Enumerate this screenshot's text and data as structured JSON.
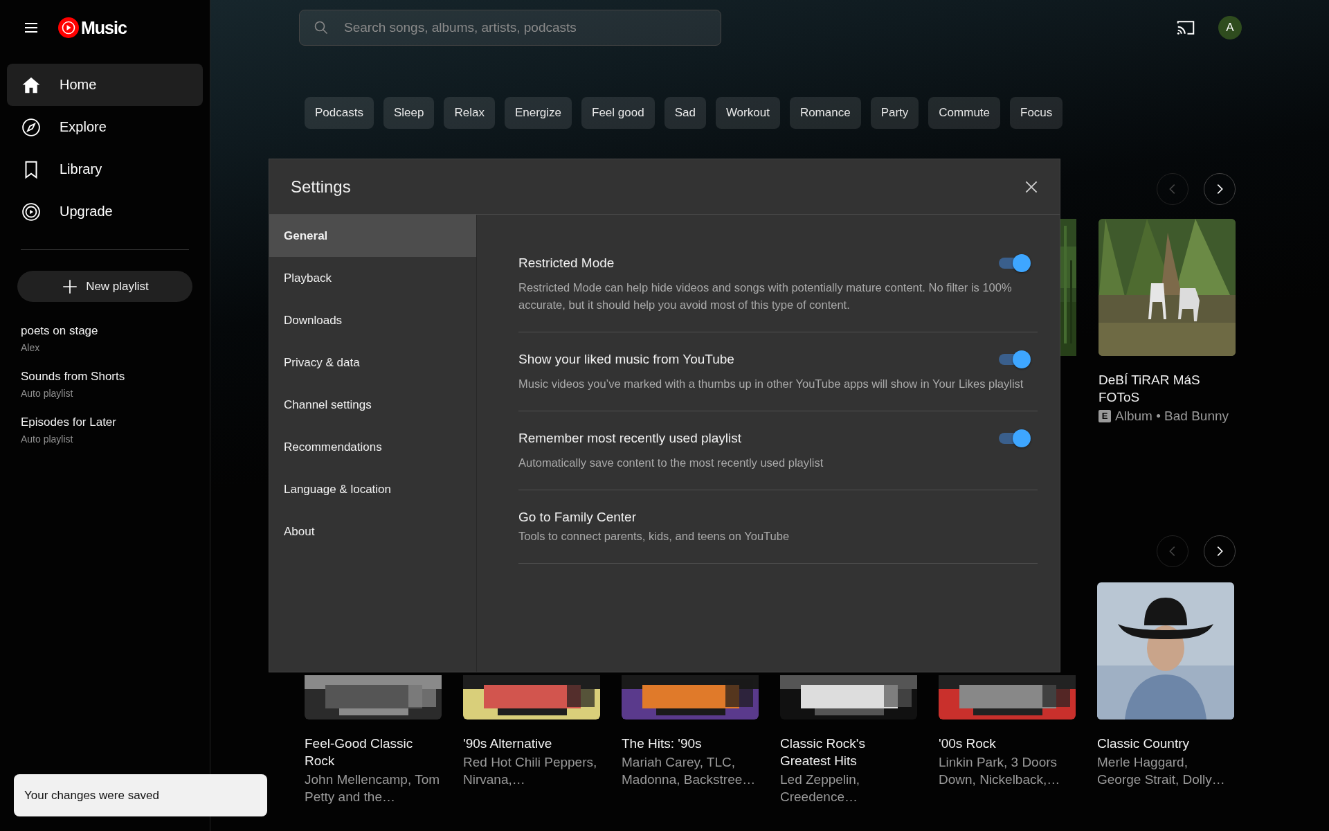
{
  "logo": {
    "text": "Music"
  },
  "sidebar": {
    "items": [
      {
        "label": "Home",
        "selected": true
      },
      {
        "label": "Explore",
        "selected": false
      },
      {
        "label": "Library",
        "selected": false
      },
      {
        "label": "Upgrade",
        "selected": false
      }
    ],
    "new_playlist": "New playlist",
    "playlists": [
      {
        "title": "poets on stage",
        "subtitle": "Alex"
      },
      {
        "title": "Sounds from Shorts",
        "subtitle": "Auto playlist"
      },
      {
        "title": "Episodes for Later",
        "subtitle": "Auto playlist"
      }
    ]
  },
  "search": {
    "placeholder": "Search songs, albums, artists, podcasts"
  },
  "avatar": {
    "initial": "A"
  },
  "chips": [
    "Podcasts",
    "Sleep",
    "Relax",
    "Energize",
    "Feel good",
    "Sad",
    "Workout",
    "Romance",
    "Party",
    "Commute",
    "Focus"
  ],
  "shelf_1": {
    "previous_disabled": true,
    "cards": [
      {
        "title": "DeBÍ TiRAR MáS FOToS",
        "explicit_badge": "E",
        "subtitle": "Album • Bad Bunny"
      }
    ]
  },
  "shelf_2": {
    "previous_disabled": true,
    "cards": [
      {
        "title": "Feel-Good Classic Rock",
        "subtitle": "John Mellencamp, Tom Petty and the…"
      },
      {
        "title": "'90s Alternative",
        "subtitle": "Red Hot Chili Peppers, Nirvana,…"
      },
      {
        "title": "The Hits: '90s",
        "subtitle": "Mariah Carey, TLC, Madonna, Backstree…"
      },
      {
        "title": "Classic Rock's Greatest Hits",
        "subtitle": "Led Zeppelin, Creedence…"
      },
      {
        "title": "'00s Rock",
        "subtitle": "Linkin Park, 3 Doors Down, Nickelback,…"
      },
      {
        "title": "Classic Country",
        "subtitle": "Merle Haggard, George Strait, Dolly…"
      }
    ]
  },
  "settings": {
    "title": "Settings",
    "nav": [
      {
        "label": "General",
        "selected": true
      },
      {
        "label": "Playback",
        "selected": false
      },
      {
        "label": "Downloads",
        "selected": false
      },
      {
        "label": "Privacy & data",
        "selected": false
      },
      {
        "label": "Channel settings",
        "selected": false
      },
      {
        "label": "Recommendations",
        "selected": false
      },
      {
        "label": "Language & location",
        "selected": false
      },
      {
        "label": "About",
        "selected": false
      }
    ],
    "options": [
      {
        "kind": "toggle",
        "title": "Restricted Mode",
        "description": "Restricted Mode can help hide videos and songs with potentially mature content. No filter is 100% accurate, but it should help you avoid most of this type of content.",
        "on": true
      },
      {
        "kind": "toggle",
        "title": "Show your liked music from YouTube",
        "description": "Music videos you’ve marked with a thumbs up in other YouTube apps will show in Your Likes playlist",
        "on": true
      },
      {
        "kind": "toggle",
        "title": "Remember most recently used playlist",
        "description": "Automatically save content to the most recently used playlist",
        "on": true
      },
      {
        "kind": "link",
        "title": "Go to Family Center",
        "description": "Tools to connect parents, kids, and teens on YouTube"
      }
    ]
  },
  "toast": {
    "text": "Your changes were saved"
  }
}
